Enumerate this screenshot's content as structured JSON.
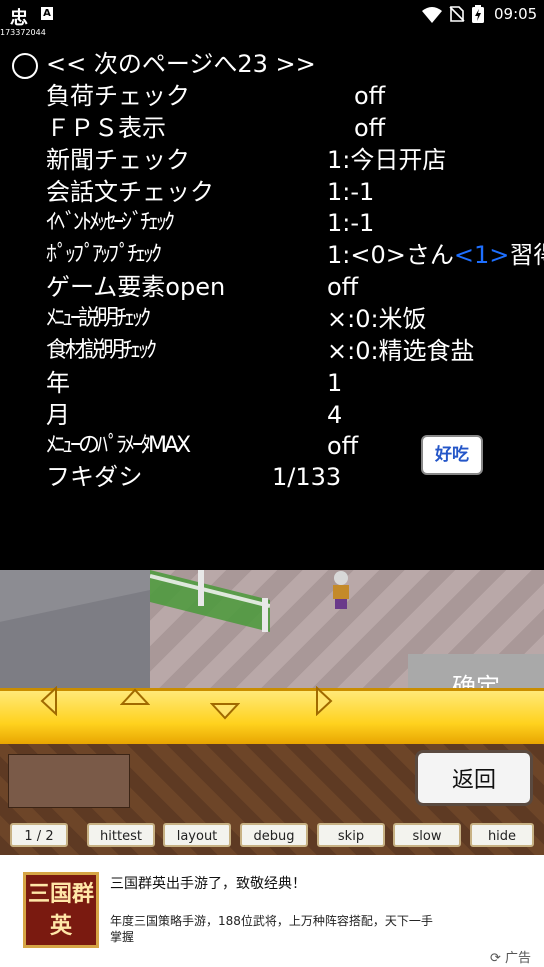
{
  "status_bar": {
    "app_icon": "忠",
    "notif_icon": "A",
    "device_id": "173372044",
    "time": "09:05",
    "icons": [
      "wifi-icon",
      "no-sim-icon",
      "battery-icon"
    ]
  },
  "menu": {
    "header": "<< 次のページへ23 >>",
    "rows": [
      {
        "label": "負荷チェック",
        "value": "off"
      },
      {
        "label": "ＦＰＳ表示",
        "value": "off"
      },
      {
        "label": "新聞チェック",
        "value": "1:今日开店"
      },
      {
        "label": "会話文チェック",
        "value": "1:-1"
      },
      {
        "label": "ｲﾍﾞﾝﾄﾒｯｾｰｼﾞﾁｪｯｸ",
        "value": "1:-1"
      },
      {
        "label": "ﾎﾟｯﾌﾟｱｯﾌﾟﾁｪｯｸ",
        "value_a": "1:<0>さん",
        "value_b": "<1>",
        "value_c": "習得"
      },
      {
        "label": "ゲーム要素open",
        "value": "off"
      },
      {
        "label": "ﾒﾆｭｰ説明ﾁｪｯｸ",
        "value": "×:0:米饭"
      },
      {
        "label": "食材説明ﾁｪｯｸ",
        "value": "×:0:精选食盐"
      },
      {
        "label": "年",
        "value": "1"
      },
      {
        "label": "月",
        "value": "4"
      },
      {
        "label": "ﾒﾆｭｰのﾊﾟﾗﾒｰﾀMAX",
        "value": "off"
      },
      {
        "label": "フキダシ",
        "value": "1/133"
      }
    ]
  },
  "speech_bubble": "好吃",
  "buttons": {
    "confirm": "确定",
    "back": "返回"
  },
  "toolbar": [
    "1 / 2",
    "hittest",
    "layout",
    "debug",
    "skip",
    "slow",
    "hide"
  ],
  "ad": {
    "logo_text": "三国群英",
    "title": "三国群英出手游了，致敬经典！",
    "description": "年度三国策略手游，188位武将，上万种阵容搭配，天下一手掌握",
    "label": "广告"
  },
  "colors": {
    "highlight": "#1e6fff",
    "gold": "#ffd21e",
    "confirm_bg": "#a9a9a9"
  }
}
